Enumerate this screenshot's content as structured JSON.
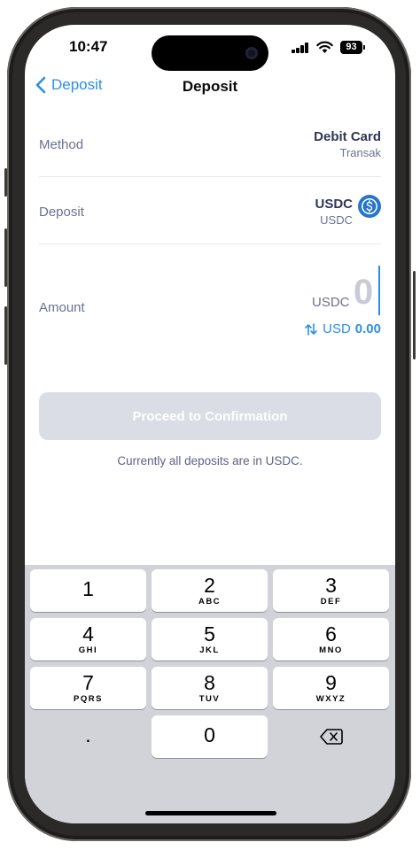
{
  "status_bar": {
    "time": "10:47",
    "battery": "93"
  },
  "nav": {
    "back_label": "Deposit",
    "title": "Deposit"
  },
  "method": {
    "label": "Method",
    "value": "Debit Card",
    "provider": "Transak"
  },
  "deposit": {
    "label": "Deposit",
    "token": "USDC",
    "token_sub": "USDC",
    "icon": "usdc-coin-icon"
  },
  "amount": {
    "label": "Amount",
    "unit": "USDC",
    "value": "0",
    "convert_unit": "USD",
    "convert_value": "0.00"
  },
  "proceed": {
    "label": "Proceed to Confirmation"
  },
  "note": "Currently all deposits are in USDC.",
  "keypad": [
    {
      "digit": "1",
      "letters": ""
    },
    {
      "digit": "2",
      "letters": "ABC"
    },
    {
      "digit": "3",
      "letters": "DEF"
    },
    {
      "digit": "4",
      "letters": "GHI"
    },
    {
      "digit": "5",
      "letters": "JKL"
    },
    {
      "digit": "6",
      "letters": "MNO"
    },
    {
      "digit": "7",
      "letters": "PQRS"
    },
    {
      "digit": "8",
      "letters": "TUV"
    },
    {
      "digit": "9",
      "letters": "WXYZ"
    },
    {
      "digit": ".",
      "letters": ""
    },
    {
      "digit": "0",
      "letters": ""
    }
  ],
  "colors": {
    "accent": "#2b8ee8",
    "usdc": "#2775ca",
    "disabled_button": "#dadde6"
  }
}
